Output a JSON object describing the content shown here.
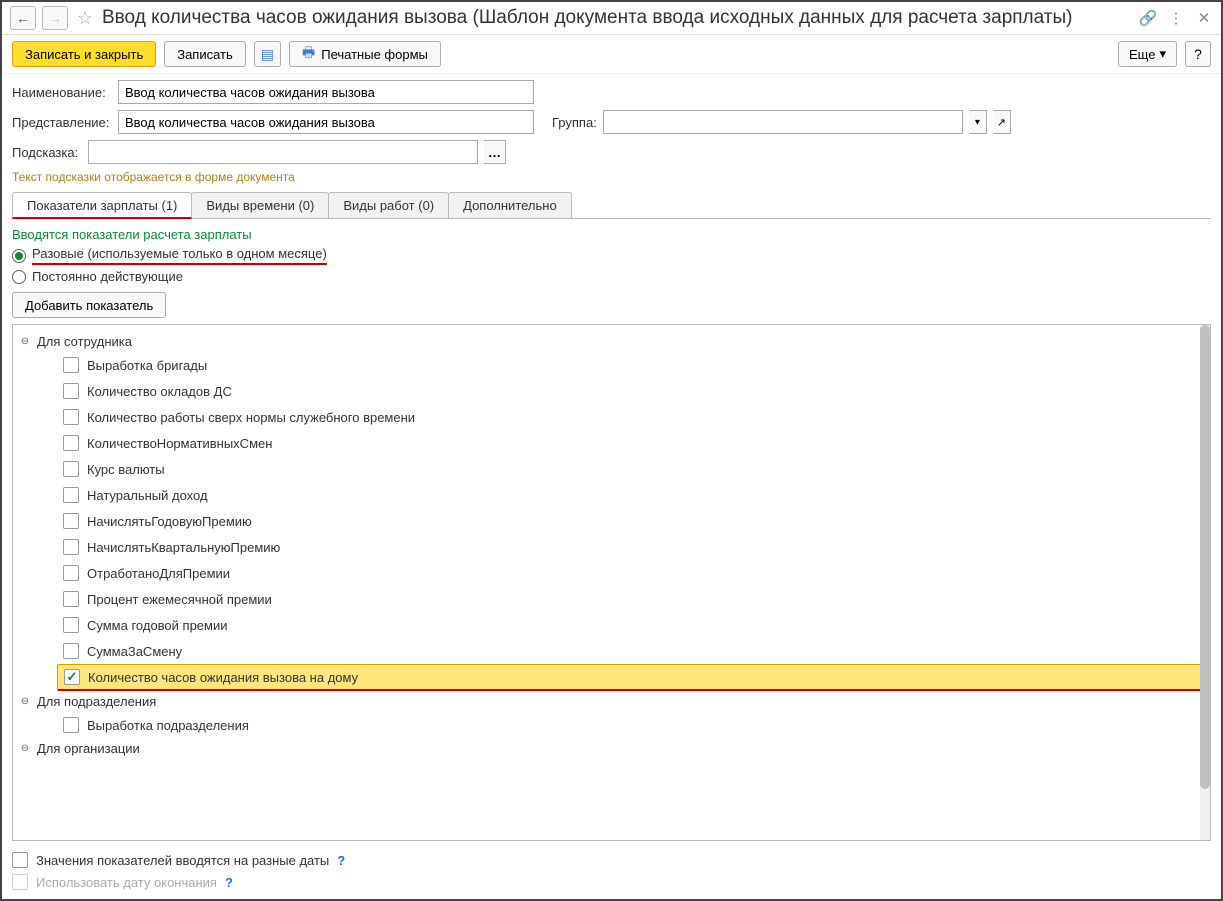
{
  "titlebar": {
    "title": "Ввод количества часов ожидания вызова (Шаблон документа ввода исходных данных для расчета зарплаты)"
  },
  "toolbar": {
    "save_close": "Записать и закрыть",
    "save": "Записать",
    "print_forms": "Печатные формы",
    "more": "Еще",
    "help": "?"
  },
  "form": {
    "name_label": "Наименование:",
    "name_value": "Ввод количества часов ожидания вызова",
    "repr_label": "Представление:",
    "repr_value": "Ввод количества часов ожидания вызова",
    "group_label": "Группа:",
    "group_value": "",
    "hint_label": "Подсказка:",
    "hint_value": "",
    "hint_help": "Текст подсказки отображается в форме документа"
  },
  "tabs": {
    "t0": "Показатели зарплаты (1)",
    "t1": "Виды времени (0)",
    "t2": "Виды работ (0)",
    "t3": "Дополнительно"
  },
  "tab_content": {
    "section_label": "Вводятся показатели расчета зарплаты",
    "radio_once": "Разовые (используемые только в одном месяце)",
    "radio_perm": "Постоянно действующие",
    "add_btn": "Добавить показатель",
    "group_employee": "Для сотрудника",
    "group_dept": "Для подразделения",
    "group_org": "Для организации",
    "items_employee": [
      "Выработка бригады",
      "Количество окладов ДС",
      "Количество работы сверх нормы служебного времени",
      "КоличествоНормативныхСмен",
      "Курс валюты",
      "Натуральный доход",
      "НачислятьГодовуюПремию",
      "НачислятьКвартальнуюПремию",
      "ОтработаноДляПремии",
      "Процент ежемесячной премии",
      "Сумма годовой премии",
      "СуммаЗаСмену",
      "Количество часов ожидания вызова на дому"
    ],
    "items_dept": [
      "Выработка подразделения"
    ]
  },
  "footer": {
    "check_dates": "Значения показателей вводятся на разные даты",
    "check_end_date": "Использовать дату окончания"
  }
}
